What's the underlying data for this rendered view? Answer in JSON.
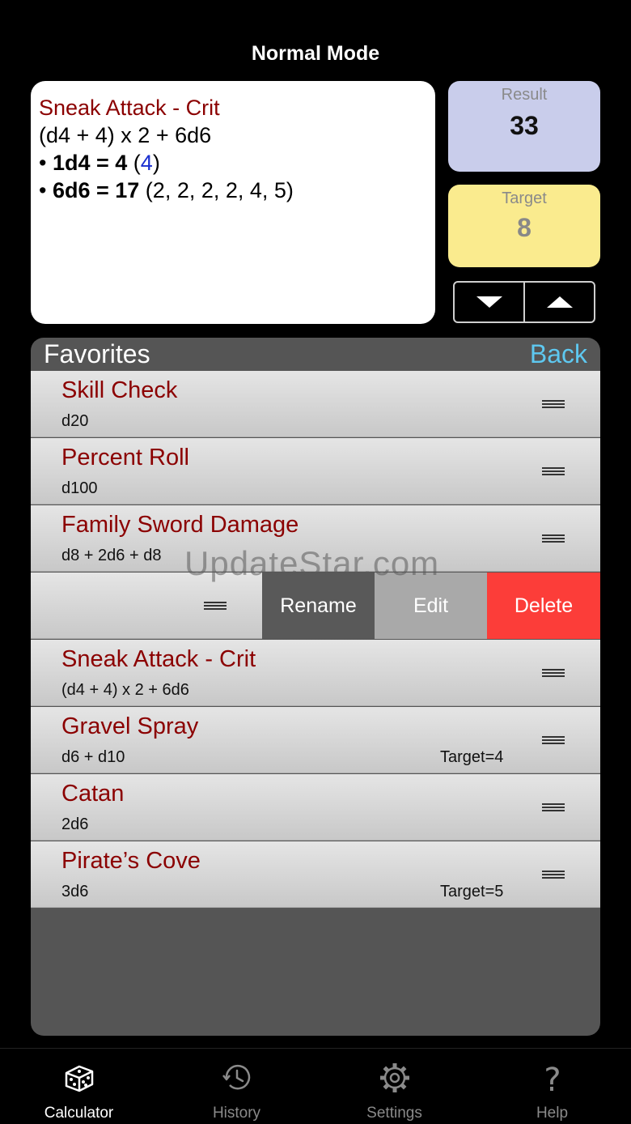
{
  "header": {
    "title": "Normal Mode"
  },
  "display": {
    "name": "Sneak Attack - Crit",
    "expression": "(d4 + 4) x 2 + 6d6",
    "lines": [
      {
        "bullet": "•",
        "term": "1d4 = 4",
        "open": " (",
        "rolls": "4",
        "close": ")"
      },
      {
        "bullet": "•",
        "term": "6d6 = 17",
        "open": " (",
        "rolls": "2, 2, 2, 2, 4, 5",
        "close": ")"
      }
    ]
  },
  "result": {
    "label": "Result",
    "value": "33"
  },
  "target": {
    "label": "Target",
    "value": "8"
  },
  "favorites": {
    "title": "Favorites",
    "back_label": "Back",
    "rows": [
      {
        "name": "Skill Check",
        "expr": "d20",
        "target": ""
      },
      {
        "name": "Percent Roll",
        "expr": "d100",
        "target": ""
      },
      {
        "name": "Family Sword Damage",
        "expr": "d8 + 2d6 + d8",
        "target": ""
      },
      {
        "name": "",
        "expr": "",
        "target": ""
      },
      {
        "name": "Sneak Attack - Crit",
        "expr": "(d4 + 4) x 2 + 6d6",
        "target": ""
      },
      {
        "name": "Gravel Spray",
        "expr": "d6 + d10",
        "target": "Target=4"
      },
      {
        "name": "Catan",
        "expr": "2d6",
        "target": ""
      },
      {
        "name": "Pirate’s Cove",
        "expr": "3d6",
        "target": "Target=5"
      }
    ],
    "swipe_actions": {
      "rename": "Rename",
      "edit": "Edit",
      "delete": "Delete"
    }
  },
  "watermark": "UpdateStar.com",
  "tabs": [
    {
      "label": "Calculator",
      "icon": "dice-icon",
      "active": true
    },
    {
      "label": "History",
      "icon": "history-clock-icon",
      "active": false
    },
    {
      "label": "Settings",
      "icon": "gear-icon",
      "active": false
    },
    {
      "label": "Help",
      "icon": "question-mark-icon",
      "active": false
    }
  ],
  "colors": {
    "background": "#000000",
    "favorite_name": "#8b0000",
    "back_link": "#5ec8f0",
    "result_bg": "#c9cdeb",
    "target_bg": "#faeb8e",
    "delete_bg": "#fc3d39"
  }
}
